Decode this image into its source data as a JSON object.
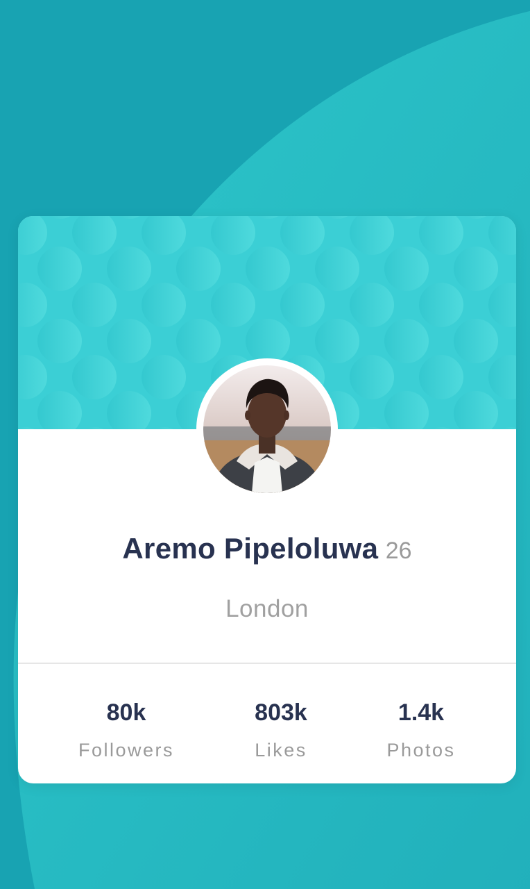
{
  "colors": {
    "background": "#18a3b2",
    "background_curve": "#2cc2c7",
    "card": "#ffffff",
    "header_pattern": "#3bcfd5",
    "name_text": "#283250",
    "muted_text": "#9a9a9a"
  },
  "profile": {
    "name": "Aremo Pipeloluwa",
    "age": "26",
    "location": "London",
    "avatar": "profile-photo"
  },
  "stats": [
    {
      "value": "80k",
      "label": "Followers"
    },
    {
      "value": "803k",
      "label": "Likes"
    },
    {
      "value": "1.4k",
      "label": "Photos"
    }
  ]
}
